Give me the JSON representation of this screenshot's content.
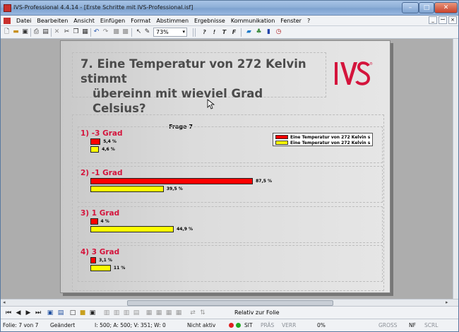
{
  "window": {
    "title": "IVS-Professional 4.4.14 - [Erste Schritte mit IVS-Professional.isf]",
    "min_symbol": "–",
    "max_symbol": "□",
    "close_symbol": "✕"
  },
  "menu": {
    "items": [
      "Datei",
      "Bearbeiten",
      "Ansicht",
      "Einfügen",
      "Format",
      "Abstimmen",
      "Ergebnisse",
      "Kommunikation",
      "Fenster",
      "?"
    ],
    "mdi_minimize": "_",
    "mdi_restore": "ꟷ",
    "mdi_close": "×"
  },
  "toolbar": {
    "zoom_value": "73%",
    "zoom_arrow": "▾",
    "icons": [
      "new-file-icon",
      "open-folder-icon",
      "save-icon",
      "print-icon",
      "page-setup-icon",
      "delete-icon",
      "cut-icon",
      "copy-icon",
      "paste-icon",
      "undo-icon",
      "redo-icon",
      "table-icon",
      "grid-icon",
      "pointer-icon",
      "pen-icon"
    ],
    "format_buttons": [
      "?",
      "!",
      "T",
      "F"
    ],
    "right_icons": [
      "chart-icon",
      "network-icon",
      "bar-chart-icon",
      "timer-icon"
    ]
  },
  "slide": {
    "question_line1": "7. Eine Temperatur von 272 Kelvin stimmt",
    "question_line2": "übereinn mit wieviel Grad Celsius?",
    "logo_text": "IVS",
    "logo_reg": "®"
  },
  "chart_data": {
    "type": "bar",
    "title": "Frage 7",
    "orientation": "horizontal",
    "categories": [
      "1) -3 Grad",
      "2) -1 Grad",
      "3) 1 Grad",
      "4) 3 Grad"
    ],
    "series": [
      {
        "name": "Eine Temperatur von 272 Kelvin s",
        "color": "#ff0000",
        "values": [
          5.4,
          87.5,
          4,
          3.1
        ],
        "labels": [
          "5,4 %",
          "87,5 %",
          "4 %",
          "3,1 %"
        ]
      },
      {
        "name": "Eine Temperatur von 272 Kelvin s",
        "color": "#ffff00",
        "values": [
          4.6,
          39.5,
          44.9,
          11
        ],
        "labels": [
          "4,6 %",
          "39,5 %",
          "44,9 %",
          "11 %"
        ]
      }
    ],
    "xlim": [
      0,
      100
    ],
    "legend": "top-right",
    "grid": false
  },
  "viewbar": {
    "relative_label": "Relativ zur Folie",
    "nav": [
      "⏮",
      "◀",
      "▶",
      "⏭"
    ]
  },
  "status": {
    "slide": "Folie: 7 von 7",
    "changed": "Geändert",
    "coords": "I: 500;  A: 500;  V: 351;  W: 0",
    "active": "Nicht aktiv",
    "sit": "SIT",
    "pras": "PRÄS",
    "verr": "VERR",
    "percent": "0%",
    "gross": "GROSS",
    "nf": "NF",
    "scrl": "SCRL"
  },
  "colors": {
    "category_label": "#d4143c",
    "series1": "#ff0000",
    "series2": "#ffff00",
    "status_red": "#e02020",
    "status_green": "#22aa22"
  }
}
